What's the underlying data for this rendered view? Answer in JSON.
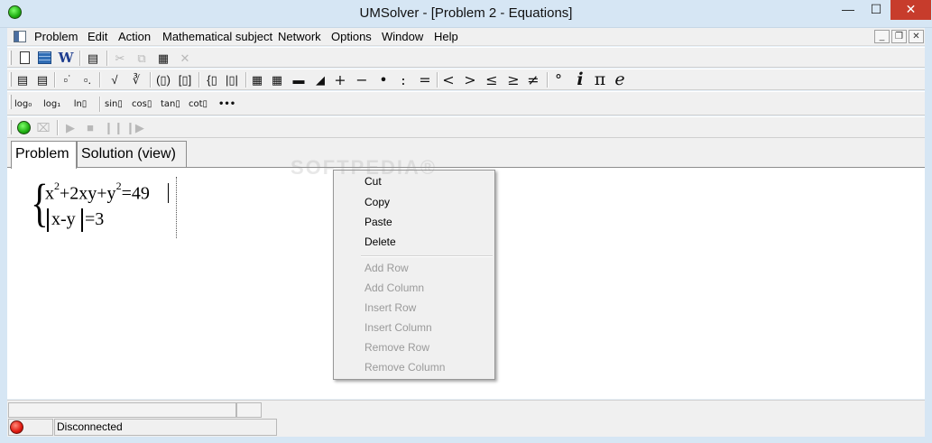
{
  "window": {
    "title": "UMSolver - [Problem 2 - Equations]",
    "minimize": "—",
    "maximize": "☐",
    "close": "✕"
  },
  "menu": {
    "items": [
      "Problem",
      "Edit",
      "Action",
      "Mathematical subject",
      "Network",
      "Options",
      "Window",
      "Help"
    ],
    "mdi_minimize": "_",
    "mdi_restore": "❐",
    "mdi_close": "✕"
  },
  "toolbar_icons": {
    "file": [
      "new-document-icon",
      "table-icon",
      "word-icon",
      "preview-icon",
      "cut-icon",
      "copy-icon",
      "paste-icon",
      "delete-icon"
    ],
    "run": [
      "run-icon",
      "clear-icon",
      "play-icon",
      "stop-icon",
      "pause-icon",
      "step-icon"
    ]
  },
  "toolbar": {
    "relations": [
      "<",
      ">",
      "≤",
      "≥",
      "≠"
    ],
    "operators": [
      "+",
      "−",
      "•",
      ":",
      "="
    ],
    "constants": [
      "°",
      "i",
      "π",
      "e"
    ],
    "functions": [
      "log₀",
      "log₁",
      "ln▯",
      "sin▯",
      "cos▯",
      "tan▯",
      "cot▯",
      "•••"
    ]
  },
  "tabs": [
    "Problem",
    "Solution (view)"
  ],
  "equations": {
    "eq1_parts": [
      "x",
      "2",
      "+2xy+y",
      "2",
      "=49"
    ],
    "eq2_inner": "x-y",
    "eq2_rest": "=3"
  },
  "context_menu": {
    "enabled": [
      "Cut",
      "Copy",
      "Paste",
      "Delete"
    ],
    "disabled": [
      "Add Row",
      "Add Column",
      "Insert Row",
      "Insert Column",
      "Remove Row",
      "Remove Column"
    ]
  },
  "watermark": "SOFTPEDIA®",
  "status": {
    "connection": "Disconnected"
  },
  "colors": {
    "title_bar": "#d6e6f4",
    "close_button": "#c73c2c",
    "status_ok": "#1fae12",
    "status_disconnected": "#e0180e"
  }
}
